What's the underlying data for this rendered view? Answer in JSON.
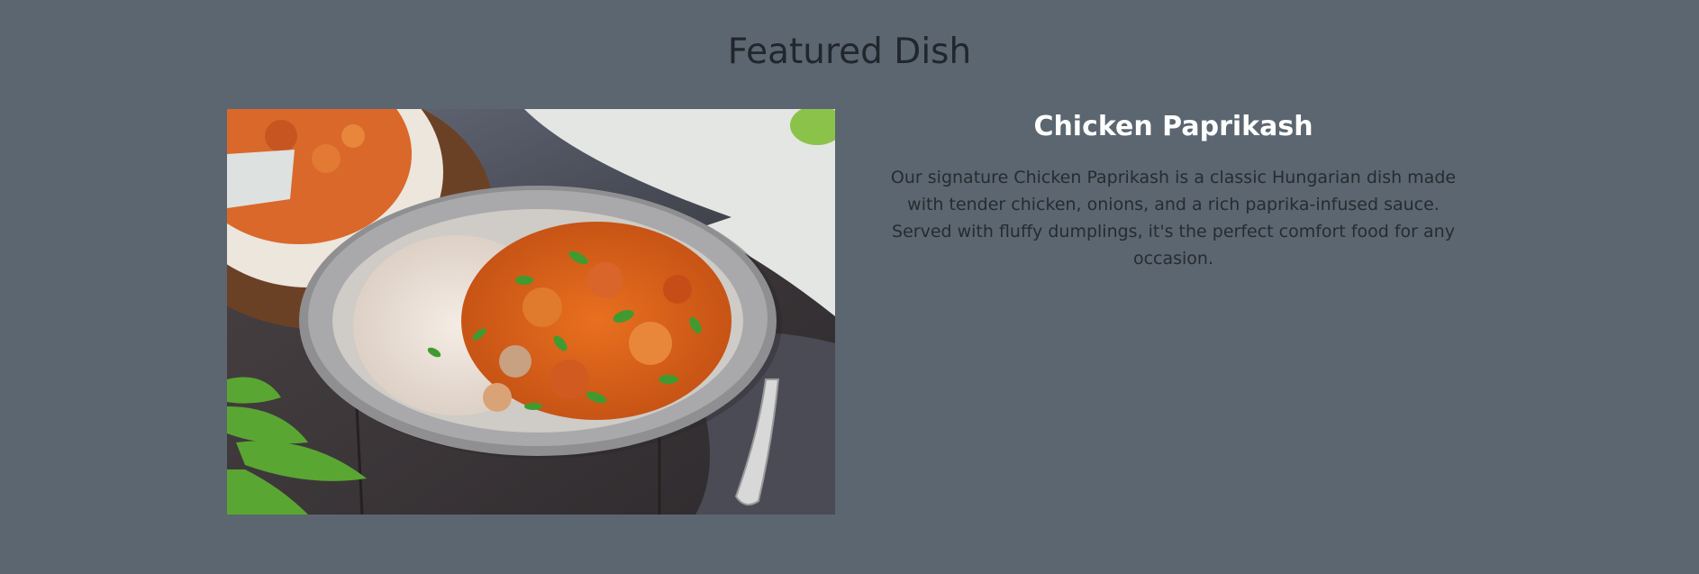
{
  "section": {
    "title": "Featured Dish"
  },
  "dish": {
    "name": "Chicken Paprikash",
    "description": "Our signature Chicken Paprikash is a classic Hungarian dish made with tender chicken, onions, and a rich paprika-infused sauce. Served with fluffy dumplings, it's the perfect comfort food for any occasion.",
    "image_alt": "Chicken Paprikash"
  },
  "colors": {
    "page_background": "#5b6670",
    "title_text": "#21262d",
    "dish_name_text": "#ffffff",
    "description_text": "#262b31"
  }
}
